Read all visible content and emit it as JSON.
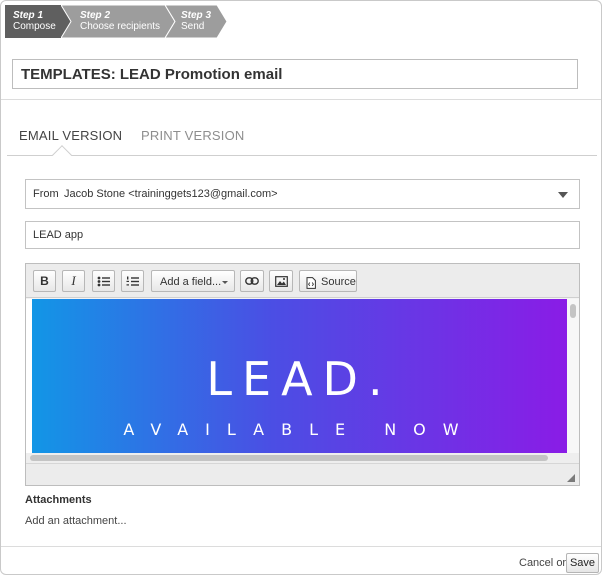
{
  "steps": [
    {
      "num": "Step 1",
      "label": "Compose",
      "active": true
    },
    {
      "num": "Step 2",
      "label": "Choose recipients",
      "active": false
    },
    {
      "num": "Step 3",
      "label": "Send",
      "active": false
    }
  ],
  "template_title": "TEMPLATES: LEAD Promotion email",
  "tabs": [
    {
      "label": "EMAIL VERSION",
      "selected": true
    },
    {
      "label": "PRINT VERSION",
      "selected": false
    }
  ],
  "from": {
    "label": "From",
    "value": "Jacob Stone <traininggets123@gmail.com>"
  },
  "subject": {
    "value": "LEAD app"
  },
  "toolbar": {
    "bold": "B",
    "italic": "I",
    "add_field": "Add a field...",
    "source": "Source"
  },
  "content": {
    "hero_title": "LEAD.",
    "hero_subtitle": "AVAILABLE NOW"
  },
  "attachments": {
    "title": "Attachments",
    "add_link": "Add an attachment..."
  },
  "footer": {
    "cancel": "Cancel",
    "or": "or",
    "save": "Save"
  },
  "colors": {
    "step_active": "#5f5f5f",
    "step_inactive": "#9d9d9d",
    "gradient_start": "#1296e6",
    "gradient_end": "#8a1ce6"
  }
}
